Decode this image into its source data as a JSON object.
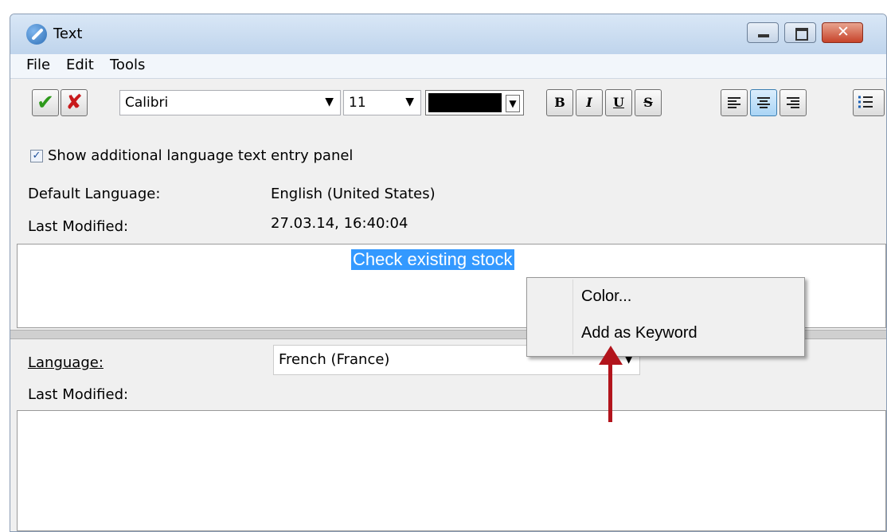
{
  "window": {
    "title": "Text"
  },
  "menu": {
    "file": "File",
    "edit": "Edit",
    "tools": "Tools"
  },
  "toolbar": {
    "ok_glyph": "✔",
    "cancel_glyph": "✘",
    "font": "Calibri",
    "size": "11",
    "color": "#000000",
    "bold": "B",
    "italic": "I",
    "underline": "U",
    "strike": "S"
  },
  "props": {
    "show_panel_label": "Show additional language text entry panel",
    "show_panel_checked": true,
    "default_language_label": "Default Language:",
    "default_language_value": "English (United States)",
    "last_modified_label": "Last Modified:",
    "last_modified_value": "27.03.14, 16:40:04"
  },
  "editor": {
    "selected_text": "Check existing stock"
  },
  "context_menu": {
    "items": [
      "Color...",
      "Add as Keyword"
    ]
  },
  "second_panel": {
    "language_label": "Language:",
    "language_value": "French (France)",
    "last_modified_label": "Last Modified:"
  },
  "colors": {
    "accent": "#3399ff",
    "annotation_arrow": "#b2141c",
    "ok": "#2e9a1c",
    "cancel": "#c8191b"
  }
}
